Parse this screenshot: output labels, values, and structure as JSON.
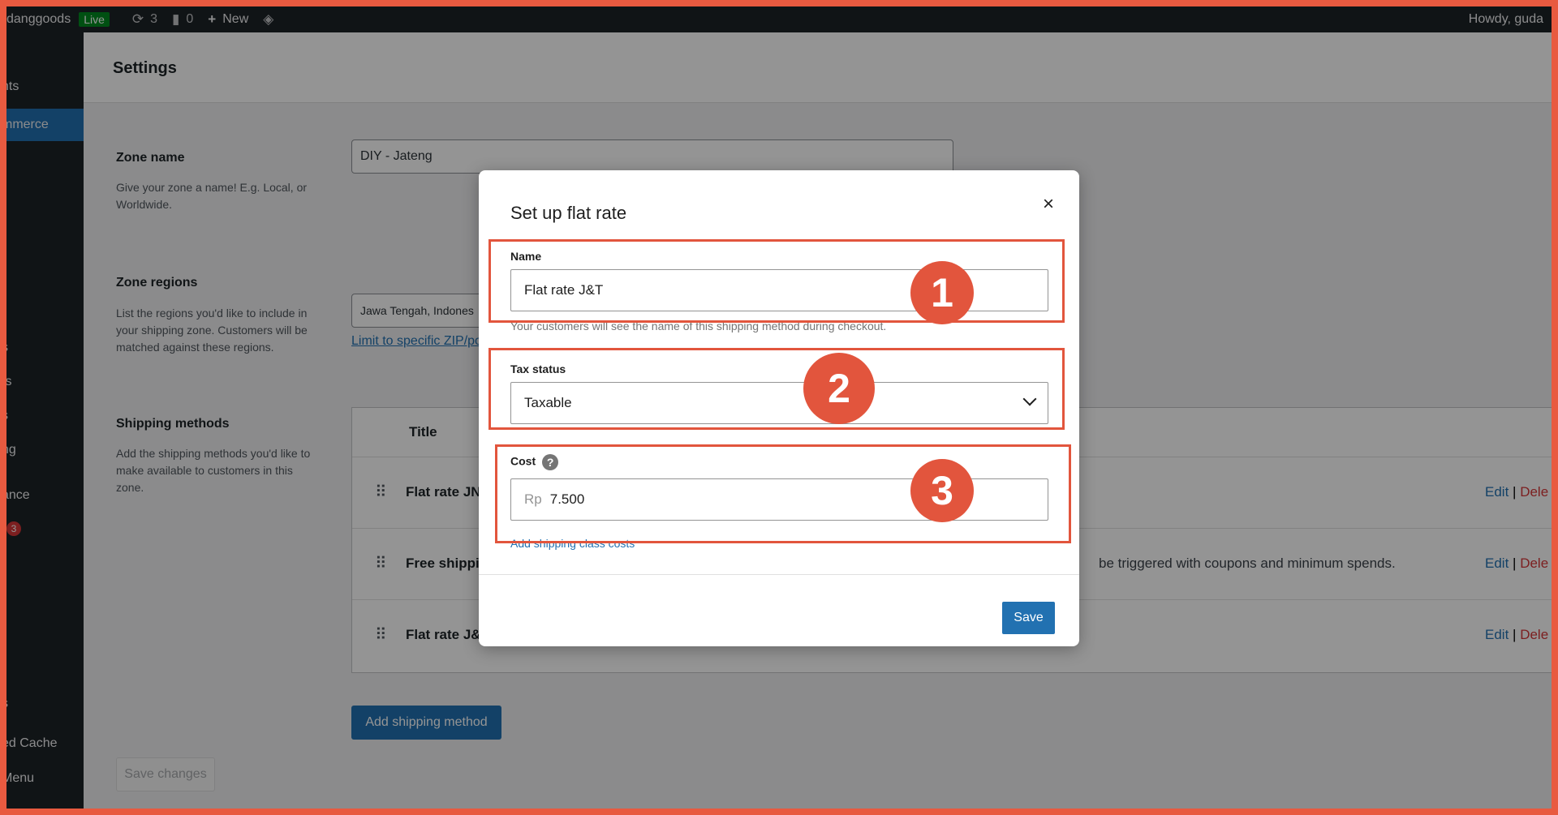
{
  "adminbar": {
    "site": "danggoods",
    "live": "Live",
    "updates_count": "3",
    "comments_count": "0",
    "new_label": "New",
    "howdy": "Howdy, guda"
  },
  "sidebar": {
    "items": [
      {
        "label": "nts"
      },
      {
        "label": "mmerce"
      },
      {
        "label": "s"
      },
      {
        "label": "ts"
      },
      {
        "label": "s"
      },
      {
        "label": "ng"
      },
      {
        "label": "ance"
      },
      {
        "label": "3"
      },
      {
        "label": "s"
      },
      {
        "label": "ed Cache"
      },
      {
        "label": "Menu"
      }
    ]
  },
  "header": {
    "title": "Settings"
  },
  "page": {
    "breadcrumb": "DIY - Jateng",
    "zone_name_label": "Zone name",
    "zone_name_value": "DIY - Jateng",
    "zone_name_help": "Give your zone a name! E.g. Local, or Worldwide.",
    "zone_regions_label": "Zone regions",
    "zone_regions_help": "List the regions you'd like to include in your shipping zone. Customers will be matched against these regions.",
    "zone_regions_value": "Jawa Tengah, Indones",
    "limit_link": "Limit to specific ZIP/po",
    "shipping_methods_label": "Shipping methods",
    "shipping_methods_help": "Add the shipping methods you'd like to make available to customers in this zone.",
    "table_title_header": "Title",
    "rows": [
      {
        "title": "Flat rate JNE",
        "desc": "",
        "edit": "Edit",
        "sep": "|",
        "delete": "Dele"
      },
      {
        "title": "Free shippin",
        "desc": "be triggered with coupons and minimum spends.",
        "edit": "Edit",
        "sep": "|",
        "delete": "Dele"
      },
      {
        "title": "Flat rate J&T",
        "desc": "",
        "edit": "Edit",
        "sep": "|",
        "delete": "Dele"
      }
    ],
    "add_method_label": "Add shipping method",
    "save_changes_label": "Save changes"
  },
  "modal": {
    "title": "Set up flat rate",
    "close_symbol": "×",
    "name_label": "Name",
    "name_value": "Flat rate J&T",
    "name_help": "Your customers will see the name of this shipping method during checkout.",
    "tax_label": "Tax status",
    "tax_value": "Taxable",
    "cost_label": "Cost",
    "cost_help_symbol": "?",
    "cost_prefix": "Rp",
    "cost_value": "7.500",
    "class_costs_link": "Add shipping class costs",
    "save_label": "Save"
  },
  "annotations": {
    "n1": "1",
    "n2": "2",
    "n3": "3",
    "color": "#e2553d"
  }
}
